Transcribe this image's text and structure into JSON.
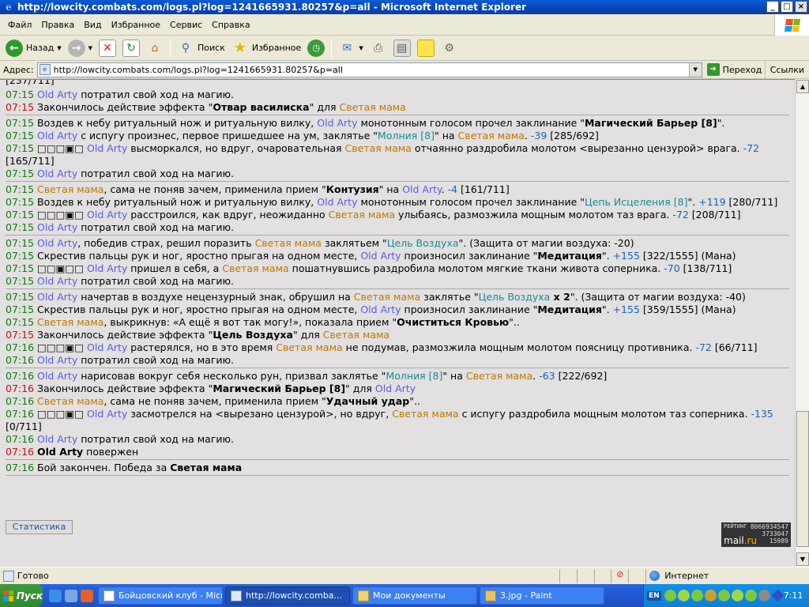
{
  "window": {
    "title": "http://lowcity.combats.com/logs.pl?log=1241665931.80257&p=all - Microsoft Internet Explorer",
    "icon_name": "ie-icon",
    "buttons": [
      "_",
      "□",
      "×"
    ]
  },
  "menu": [
    "Файл",
    "Правка",
    "Вид",
    "Избранное",
    "Сервис",
    "Справка"
  ],
  "toolbar": {
    "back": "Назад",
    "search": "Поиск",
    "favorites": "Избранное"
  },
  "address": {
    "label": "Адрес:",
    "url": "http://lowcity.combats.com/logs.pl?log=1241665931.80257&p=all",
    "go": "Переход",
    "links": "Ссылки"
  },
  "log": {
    "top_partial": "[237/711]",
    "blocks": [
      [
        [
          [
            "t",
            "07:15"
          ],
          [
            "s",
            " "
          ],
          [
            "n1",
            "Old Arty"
          ],
          [
            "s",
            " потратил свой ход на магию."
          ]
        ],
        [
          [
            "tr",
            "07:15"
          ],
          [
            "s",
            " Закончилось действие эффекта \""
          ],
          [
            "b",
            "Отвар василиска"
          ],
          [
            "s",
            "\" для "
          ],
          [
            "n2",
            "Светая мама"
          ]
        ]
      ],
      [
        [
          [
            "t",
            "07:15"
          ],
          [
            "s",
            " Воздев к небу ритуальный нож и ритуальную вилку, "
          ],
          [
            "n1",
            "Old Arty"
          ],
          [
            "s",
            " монотонным голосом прочел заклинание \""
          ],
          [
            "b",
            "Магический Барьер [8]"
          ],
          [
            "s",
            "\"."
          ]
        ],
        [
          [
            "t",
            "07:15"
          ],
          [
            "s",
            " "
          ],
          [
            "n1",
            "Old Arty"
          ],
          [
            "s",
            " с испугу произнес, первое пришедшее на ум, заклятье \""
          ],
          [
            "sp",
            "Молния [8]"
          ],
          [
            "s",
            "\" на "
          ],
          [
            "n2",
            "Светая мама"
          ],
          [
            "s",
            ". "
          ],
          [
            "dmg",
            "-39"
          ],
          [
            "s",
            " [285/692]"
          ]
        ],
        [
          [
            "t",
            "07:15"
          ],
          [
            "s",
            " □□□▣□ "
          ],
          [
            "n1",
            "Old Arty"
          ],
          [
            "s",
            " высморкался, но вдруг, очаровательная "
          ],
          [
            "n2",
            "Светая мама"
          ],
          [
            "s",
            " отчаянно раздробила молотом <вырезанно цензурой> врага. "
          ],
          [
            "dmg",
            "-72"
          ],
          [
            "s",
            " [165/711]"
          ]
        ],
        [
          [
            "t",
            "07:15"
          ],
          [
            "s",
            " "
          ],
          [
            "n1",
            "Old Arty"
          ],
          [
            "s",
            " потратил свой ход на магию."
          ]
        ]
      ],
      [
        [
          [
            "t",
            "07:15"
          ],
          [
            "s",
            " "
          ],
          [
            "n2",
            "Светая мама"
          ],
          [
            "s",
            ", сама не поняв зачем, применила прием \""
          ],
          [
            "b",
            "Контузия"
          ],
          [
            "s",
            "\" на "
          ],
          [
            "n1",
            "Old Arty"
          ],
          [
            "s",
            ". "
          ],
          [
            "dmg",
            "-4"
          ],
          [
            "s",
            " [161/711]"
          ]
        ],
        [
          [
            "t",
            "07:15"
          ],
          [
            "s",
            " Воздев к небу ритуальный нож и ритуальную вилку, "
          ],
          [
            "n1",
            "Old Arty"
          ],
          [
            "s",
            " монотонным голосом прочел заклинание \""
          ],
          [
            "sp",
            "Цепь Исцеления [8]"
          ],
          [
            "s",
            "\". "
          ],
          [
            "dmg",
            "+119"
          ],
          [
            "s",
            " [280/711]"
          ]
        ],
        [
          [
            "t",
            "07:15"
          ],
          [
            "s",
            " □□□▣□ "
          ],
          [
            "n1",
            "Old Arty"
          ],
          [
            "s",
            " расстроился, как вдруг, неожиданно "
          ],
          [
            "n2",
            "Светая мама"
          ],
          [
            "s",
            " улыбаясь, размозжила мощным молотом таз врага. "
          ],
          [
            "dmg",
            "-72"
          ],
          [
            "s",
            " [208/711]"
          ]
        ],
        [
          [
            "t",
            "07:15"
          ],
          [
            "s",
            " "
          ],
          [
            "n1",
            "Old Arty"
          ],
          [
            "s",
            " потратил свой ход на магию."
          ]
        ]
      ],
      [
        [
          [
            "t",
            "07:15"
          ],
          [
            "s",
            " "
          ],
          [
            "n1",
            "Old Arty"
          ],
          [
            "s",
            ", победив страх, решил поразить "
          ],
          [
            "n2",
            "Светая мама"
          ],
          [
            "s",
            " заклятьем \""
          ],
          [
            "sp",
            "Цель Воздуха"
          ],
          [
            "s",
            "\". (Защита от магии воздуха: -20)"
          ]
        ],
        [
          [
            "t",
            "07:15"
          ],
          [
            "s",
            " Скрестив пальцы рук и ног, яростно прыгая на одном месте, "
          ],
          [
            "n1",
            "Old Arty"
          ],
          [
            "s",
            " произносил заклинание \""
          ],
          [
            "b",
            "Медитация"
          ],
          [
            "s",
            "\". "
          ],
          [
            "dmg",
            "+155"
          ],
          [
            "s",
            " [322/1555] (Мана)"
          ]
        ],
        [
          [
            "t",
            "07:15"
          ],
          [
            "s",
            " □□▣□□ "
          ],
          [
            "n1",
            "Old Arty"
          ],
          [
            "s",
            " пришел в себя, а "
          ],
          [
            "n2",
            "Светая мама"
          ],
          [
            "s",
            " пошатнувшись раздробила молотом мягкие ткани живота соперника. "
          ],
          [
            "dmg",
            "-70"
          ],
          [
            "s",
            " [138/711]"
          ]
        ],
        [
          [
            "t",
            "07:15"
          ],
          [
            "s",
            " "
          ],
          [
            "n1",
            "Old Arty"
          ],
          [
            "s",
            " потратил свой ход на магию."
          ]
        ]
      ],
      [
        [
          [
            "t",
            "07:15"
          ],
          [
            "s",
            " "
          ],
          [
            "n1",
            "Old Arty"
          ],
          [
            "s",
            " начертав в воздухе нецензурный знак, обрушил на "
          ],
          [
            "n2",
            "Светая мама"
          ],
          [
            "s",
            " заклятье \""
          ],
          [
            "sp",
            "Цель Воздуха"
          ],
          [
            "b",
            " x 2"
          ],
          [
            "s",
            "\". (Защита от магии воздуха: -40)"
          ]
        ],
        [
          [
            "t",
            "07:15"
          ],
          [
            "s",
            " Скрестив пальцы рук и ног, яростно прыгая на одном месте, "
          ],
          [
            "n1",
            "Old Arty"
          ],
          [
            "s",
            " произносил заклинание \""
          ],
          [
            "b",
            "Медитация"
          ],
          [
            "s",
            "\". "
          ],
          [
            "dmg",
            "+155"
          ],
          [
            "s",
            " [359/1555] (Мана)"
          ]
        ],
        [
          [
            "t",
            "07:15"
          ],
          [
            "s",
            " "
          ],
          [
            "n2",
            "Светая мама"
          ],
          [
            "s",
            ", выкрикнув: «А ещё я вот так могу!», показала прием \""
          ],
          [
            "b",
            "Очиститься Кровью"
          ],
          [
            "s",
            "\".."
          ]
        ],
        [
          [
            "tr",
            "07:15"
          ],
          [
            "s",
            " Закончилось действие эффекта \""
          ],
          [
            "b",
            "Цель Воздуха"
          ],
          [
            "s",
            "\" для "
          ],
          [
            "n2",
            "Светая мама"
          ]
        ],
        [
          [
            "t",
            "07:16"
          ],
          [
            "s",
            " □□□▣□ "
          ],
          [
            "n1",
            "Old Arty"
          ],
          [
            "s",
            " растерялся, но в это время "
          ],
          [
            "n2",
            "Светая мама"
          ],
          [
            "s",
            " не подумав, размозжила мощным молотом поясницу противника. "
          ],
          [
            "dmg",
            "-72"
          ],
          [
            "s",
            " [66/711]"
          ]
        ],
        [
          [
            "t",
            "07:16"
          ],
          [
            "s",
            " "
          ],
          [
            "n1",
            "Old Arty"
          ],
          [
            "s",
            " потратил свой ход на магию."
          ]
        ]
      ],
      [
        [
          [
            "t",
            "07:16"
          ],
          [
            "s",
            " "
          ],
          [
            "n1",
            "Old Arty"
          ],
          [
            "s",
            " нарисовав вокруг себя несколько рун, призвал заклятье \""
          ],
          [
            "sp",
            "Молния [8]"
          ],
          [
            "s",
            "\" на "
          ],
          [
            "n2",
            "Светая мама"
          ],
          [
            "s",
            ". "
          ],
          [
            "dmg",
            "-63"
          ],
          [
            "s",
            " [222/692]"
          ]
        ],
        [
          [
            "tr",
            "07:16"
          ],
          [
            "s",
            " Закончилось действие эффекта \""
          ],
          [
            "b",
            "Магический Барьер [8]"
          ],
          [
            "s",
            "\" для "
          ],
          [
            "n1",
            "Old Arty"
          ]
        ],
        [
          [
            "t",
            "07:16"
          ],
          [
            "s",
            " "
          ],
          [
            "n2",
            "Светая мама"
          ],
          [
            "s",
            ", сама не поняв зачем, применила прием \""
          ],
          [
            "b",
            "Удачный удар"
          ],
          [
            "s",
            "\".."
          ]
        ],
        [
          [
            "t",
            "07:16"
          ],
          [
            "s",
            " □□□▣□ "
          ],
          [
            "n1",
            "Old Arty"
          ],
          [
            "s",
            " засмотрелся на <вырезано цензурой>, но вдруг, "
          ],
          [
            "n2",
            "Светая мама"
          ],
          [
            "s",
            " с испугу раздробила мощным молотом таз соперника. "
          ],
          [
            "dmg",
            "-135"
          ],
          [
            "s",
            " [0/711]"
          ]
        ],
        [
          [
            "t",
            "07:16"
          ],
          [
            "s",
            " "
          ],
          [
            "n1",
            "Old Arty"
          ],
          [
            "s",
            " потратил свой ход на магию."
          ]
        ],
        [
          [
            "tr",
            "07:16"
          ],
          [
            "s",
            " "
          ],
          [
            "nb",
            "Old Arty"
          ],
          [
            "s",
            " повержен"
          ]
        ]
      ],
      [
        [
          [
            "t",
            "07:16"
          ],
          [
            "s",
            " Бой закончен. Победа за "
          ],
          [
            "nb",
            "Светая мама"
          ]
        ]
      ]
    ]
  },
  "stats_button": "Статистика",
  "rating": {
    "label": "РЕЙТИНГ",
    "n1": "8066934547",
    "n2": "3733047",
    "n3": "15989",
    "mail": "mail",
    "ru": ".ru"
  },
  "status": {
    "text": "Готово",
    "zone": "Интернет"
  },
  "taskbar": {
    "start": "Пуск",
    "tasks": [
      {
        "label": "Бойцовский клуб - Micr...",
        "active": false
      },
      {
        "label": "http://lowcity.comba...",
        "active": true
      },
      {
        "label": "Мои документы",
        "active": false
      },
      {
        "label": "3.jpg - Paint",
        "active": false
      }
    ],
    "lang": "EN",
    "clock": "7:11"
  }
}
